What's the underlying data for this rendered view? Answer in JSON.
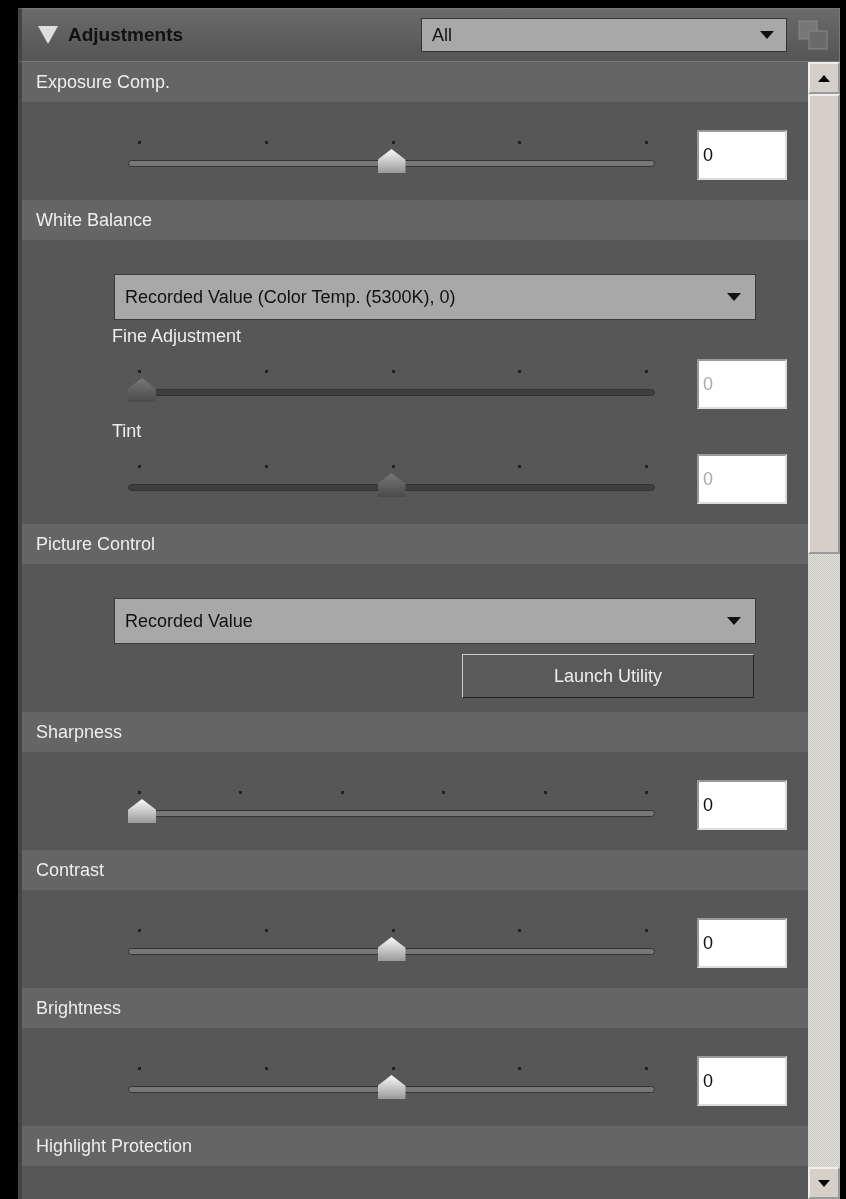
{
  "panel": {
    "title": "Adjustments",
    "expanded": true,
    "filter": {
      "value": "All"
    }
  },
  "sections": [
    {
      "title": "Exposure Comp.",
      "items": [
        {
          "kind": "slider",
          "level": 0.5,
          "value": "0",
          "disabled": false
        }
      ]
    },
    {
      "title": "White Balance",
      "items": [
        {
          "kind": "dropdown",
          "value": "Recorded Value (Color Temp. (5300K), 0)"
        },
        {
          "kind": "slider",
          "label": "Fine Adjustment",
          "level": 0,
          "value": "0",
          "disabled": true
        },
        {
          "kind": "slider",
          "label": "Tint",
          "level": 0.5,
          "value": "0",
          "disabled": true
        }
      ]
    },
    {
      "title": "Picture Control",
      "items": [
        {
          "kind": "dropdown",
          "value": "Recorded Value"
        },
        {
          "kind": "button",
          "label": "Launch Utility"
        }
      ]
    },
    {
      "title": "Sharpness",
      "items": [
        {
          "kind": "stepslider",
          "level": 0,
          "value": "0",
          "disabled": false
        }
      ]
    },
    {
      "title": "Contrast",
      "items": [
        {
          "kind": "slider",
          "level": 0.5,
          "value": "0",
          "disabled": false
        }
      ]
    },
    {
      "title": "Brightness",
      "items": [
        {
          "kind": "slider",
          "level": 0.5,
          "value": "0",
          "disabled": false
        }
      ]
    },
    {
      "title": "Highlight Protection"
    }
  ]
}
